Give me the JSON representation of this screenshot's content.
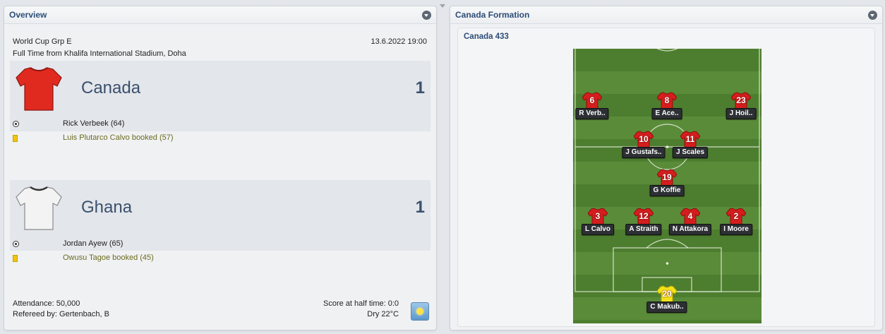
{
  "overview": {
    "title": "Overview",
    "competition": "World Cup Grp E",
    "datetime": "13.6.2022 19:00",
    "venue": "Full Time from Khalifa International Stadium, Doha",
    "home": {
      "name": "Canada",
      "score": "1",
      "shirt_color": "#e02a1f",
      "goal": "Rick Verbeek (64)",
      "booking": "Luis Plutarco Calvo booked (57)"
    },
    "away": {
      "name": "Ghana",
      "score": "1",
      "shirt_color": "#f3f3f3",
      "goal": "Jordan Ayew (65)",
      "booking": "Owusu Tagoe booked (45)"
    },
    "attendance": "Attendance: 50,000",
    "referee": "Refereed by: Gertenbach, B",
    "half_time": "Score at half time: 0:0",
    "weather": "Dry 22°C",
    "weather_icon": "sun-icon"
  },
  "formation": {
    "panel_title": "Canada Formation",
    "formation_name": "Canada 433",
    "players": [
      {
        "number": "6",
        "name": "R Verb..",
        "color": "#d41e1e"
      },
      {
        "number": "8",
        "name": "E Ace..",
        "color": "#d41e1e"
      },
      {
        "number": "23",
        "name": "J Hoil..",
        "color": "#d41e1e"
      },
      {
        "number": "10",
        "name": "J Gustafs..",
        "color": "#d41e1e"
      },
      {
        "number": "11",
        "name": "J Scales",
        "color": "#d41e1e"
      },
      {
        "number": "19",
        "name": "G Koffie",
        "color": "#d41e1e"
      },
      {
        "number": "3",
        "name": "L Calvo",
        "color": "#d41e1e"
      },
      {
        "number": "12",
        "name": "A Straith",
        "color": "#d41e1e"
      },
      {
        "number": "4",
        "name": "N Attakora",
        "color": "#d41e1e"
      },
      {
        "number": "2",
        "name": "I Moore",
        "color": "#d41e1e"
      },
      {
        "number": "20",
        "name": "C Makub..",
        "color": "#f3e21b"
      }
    ]
  }
}
